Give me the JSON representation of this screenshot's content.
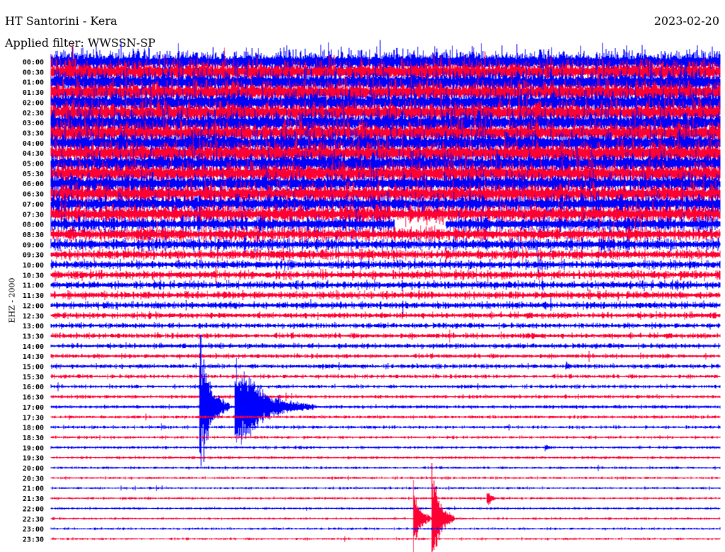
{
  "header": {
    "title": "HT Santorini - Kera",
    "date": "2023-02-20",
    "filter": "Applied filter: WWSSN-SP",
    "channel": "EHZ - 2000"
  },
  "colors": {
    "even": "#0000ff",
    "odd": "#ff0033"
  },
  "chart_data": {
    "type": "line",
    "title": "HT Santorini - Kera",
    "minutes_per_row": 30,
    "row_labels": [
      "00:00",
      "00:30",
      "01:00",
      "01:30",
      "02:00",
      "02:30",
      "03:00",
      "03:30",
      "04:00",
      "04:30",
      "05:00",
      "05:30",
      "06:00",
      "06:30",
      "07:00",
      "07:30",
      "08:00",
      "08:30",
      "09:00",
      "09:30",
      "10:00",
      "10:30",
      "11:00",
      "11:30",
      "12:00",
      "12:30",
      "13:00",
      "13:30",
      "14:00",
      "14:30",
      "15:00",
      "15:30",
      "16:00",
      "16:30",
      "17:00",
      "17:30",
      "18:00",
      "18:30",
      "19:00",
      "19:30",
      "20:00",
      "20:30",
      "21:00",
      "21:30",
      "22:00",
      "22:30",
      "23:00",
      "23:30"
    ],
    "noise_amplitude_rows": [
      1.4,
      1.4,
      1.4,
      1.4,
      1.4,
      1.4,
      1.4,
      1.4,
      1.4,
      1.4,
      1.3,
      1.3,
      1.2,
      1.2,
      1.1,
      1.1,
      0.9,
      0.8,
      0.7,
      0.6,
      0.5,
      0.5,
      0.45,
      0.45,
      0.4,
      0.35,
      0.3,
      0.3,
      0.28,
      0.25,
      0.25,
      0.22,
      0.2,
      0.2,
      0.2,
      0.18,
      0.18,
      0.16,
      0.16,
      0.15,
      0.14,
      0.14,
      0.14,
      0.14,
      0.13,
      0.13,
      0.13,
      0.13
    ],
    "events": [
      {
        "row": 34,
        "minute": 6.7,
        "amplitude_rows": 9.0,
        "duration_min": 1.3
      },
      {
        "row": 34,
        "minute": 8.3,
        "amplitude_rows": 6.0,
        "duration_min": 3.5
      },
      {
        "row": 34,
        "minute": 10.9,
        "amplitude_rows": 0.8,
        "duration_min": 1.2
      },
      {
        "row": 45,
        "minute": 16.3,
        "amplitude_rows": 4.0,
        "duration_min": 0.8
      },
      {
        "row": 45,
        "minute": 17.1,
        "amplitude_rows": 7.0,
        "duration_min": 1.0
      },
      {
        "row": 43,
        "minute": 19.6,
        "amplitude_rows": 1.0,
        "duration_min": 0.5
      },
      {
        "row": 30,
        "minute": 23.1,
        "amplitude_rows": 0.6,
        "duration_min": 0.8
      },
      {
        "row": 38,
        "minute": 22.2,
        "amplitude_rows": 0.5,
        "duration_min": 0.4
      },
      {
        "row": 27,
        "minute": 21.6,
        "amplitude_rows": 0.5,
        "duration_min": 0.6
      },
      {
        "row": 14,
        "minute": 23.8,
        "amplitude_rows": 2.5,
        "duration_min": 0.4
      }
    ],
    "gaps": [
      {
        "row": 16,
        "start_min": 15.4,
        "end_min": 17.7
      }
    ]
  }
}
